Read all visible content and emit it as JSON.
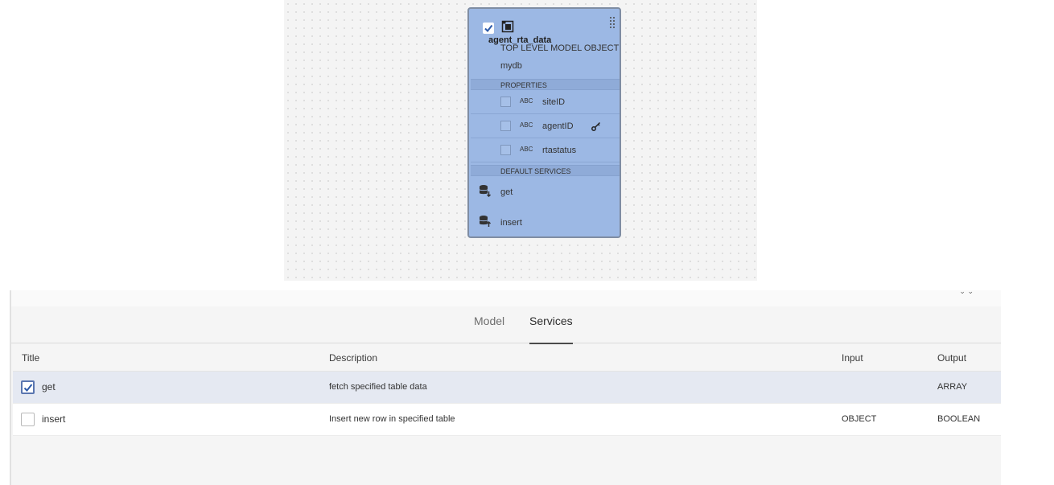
{
  "canvas": {
    "model": {
      "name": "agent_rta_data",
      "subtitle": "TOP LEVEL MODEL OBJECT",
      "database": "mydb",
      "properties_header": "PROPERTIES",
      "properties": [
        {
          "type": "ABC",
          "name": "siteID",
          "is_key": false
        },
        {
          "type": "ABC",
          "name": "agentID",
          "is_key": true
        },
        {
          "type": "ABC",
          "name": "rtastatus",
          "is_key": false
        }
      ],
      "services_header": "DEFAULT SERVICES",
      "services": [
        {
          "name": "get",
          "icon": "database-download-icon"
        },
        {
          "name": "insert",
          "icon": "database-upload-icon"
        }
      ]
    }
  },
  "panel": {
    "tabs": [
      {
        "label": "Model",
        "active": false
      },
      {
        "label": "Services",
        "active": true
      }
    ],
    "table": {
      "columns": [
        "Title",
        "Description",
        "Input",
        "Output"
      ],
      "rows": [
        {
          "title": "get",
          "description": "fetch specified table data",
          "input": "",
          "output": "ARRAY",
          "checked": true
        },
        {
          "title": "insert",
          "description": "Insert new row in specified table",
          "input": "OBJECT",
          "output": "BOOLEAN",
          "checked": false
        }
      ]
    }
  },
  "colors": {
    "card_fill": "#9cb8e4",
    "card_border": "#7f8da3",
    "selected_row": "#e5e9f2",
    "accent": "#5a76b0"
  }
}
